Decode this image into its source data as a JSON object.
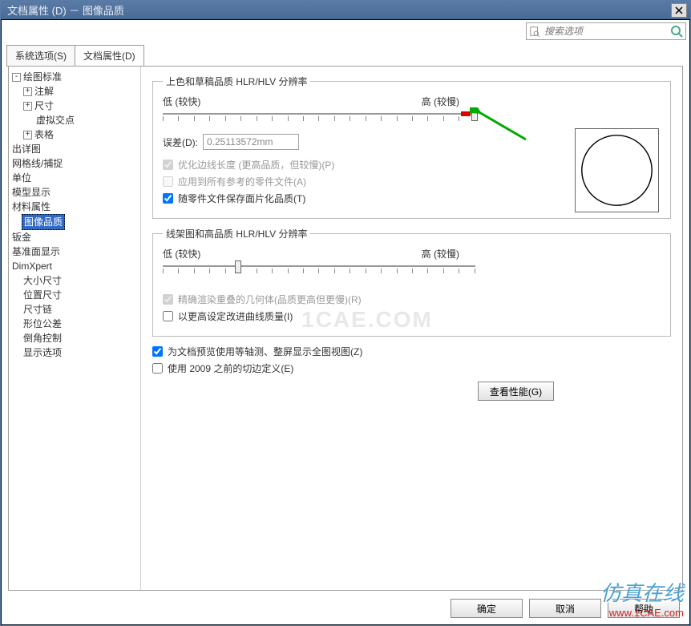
{
  "title": "文档属性 (D) － 图像品质",
  "search_placeholder": "搜索选项",
  "tabs": {
    "sys": "系统选项(S)",
    "doc": "文档属性(D)"
  },
  "tree": {
    "items": [
      {
        "label": "绘图标准",
        "indent": 0,
        "exp": "-"
      },
      {
        "label": "注解",
        "indent": 1,
        "exp": "+"
      },
      {
        "label": "尺寸",
        "indent": 1,
        "exp": "+"
      },
      {
        "label": "虚拟交点",
        "indent": 2,
        "exp": ""
      },
      {
        "label": "表格",
        "indent": 1,
        "exp": "+"
      },
      {
        "label": "出详图",
        "indent": 0,
        "exp": ""
      },
      {
        "label": "网格线/捕捉",
        "indent": 0,
        "exp": ""
      },
      {
        "label": "单位",
        "indent": 0,
        "exp": ""
      },
      {
        "label": "模型显示",
        "indent": 0,
        "exp": ""
      },
      {
        "label": "材料属性",
        "indent": 0,
        "exp": ""
      },
      {
        "label": "图像品质",
        "indent": 0,
        "exp": "",
        "selected": true
      },
      {
        "label": "钣金",
        "indent": 0,
        "exp": ""
      },
      {
        "label": "基准面显示",
        "indent": 0,
        "exp": ""
      },
      {
        "label": "DimXpert",
        "indent": 0,
        "exp": ""
      },
      {
        "label": "大小尺寸",
        "indent": 1,
        "exp": ""
      },
      {
        "label": "位置尺寸",
        "indent": 1,
        "exp": ""
      },
      {
        "label": "尺寸链",
        "indent": 1,
        "exp": ""
      },
      {
        "label": "形位公差",
        "indent": 1,
        "exp": ""
      },
      {
        "label": "倒角控制",
        "indent": 1,
        "exp": ""
      },
      {
        "label": "显示选项",
        "indent": 1,
        "exp": ""
      }
    ]
  },
  "group1": {
    "legend": "上色和草稿品质 HLR/HLV 分辨率",
    "low": "低 (较快)",
    "high": "高 (较慢)",
    "dev_label": "误差(D):",
    "dev_value": "0.25113572mm",
    "chk_opt": "优化边线长度 (更高品质，但较慢)(P)",
    "chk_apply": "应用到所有参考的零件文件(A)",
    "chk_save": "随零件文件保存面片化品质(T)"
  },
  "group2": {
    "legend": "线架图和高品质 HLR/HLV 分辨率",
    "low": "低 (较快)",
    "high": "高 (较慢)",
    "chk_render": "精确渲染重叠的几何体(品质更高但更慢)(R)",
    "chk_improve": "以更高设定改进曲线质量(I)"
  },
  "chk_iso": "为文档预览使用等轴测、整屏显示全图视图(Z)",
  "chk_2009": "使用 2009 之前的切边定义(E)",
  "perf_btn": "查看性能(G)",
  "buttons": {
    "ok": "确定",
    "cancel": "取消",
    "help": "帮助"
  },
  "watermark": {
    "line1": "仿真在线",
    "line2": "www.1CAE.com"
  },
  "bg_wm": "1CAE.COM"
}
